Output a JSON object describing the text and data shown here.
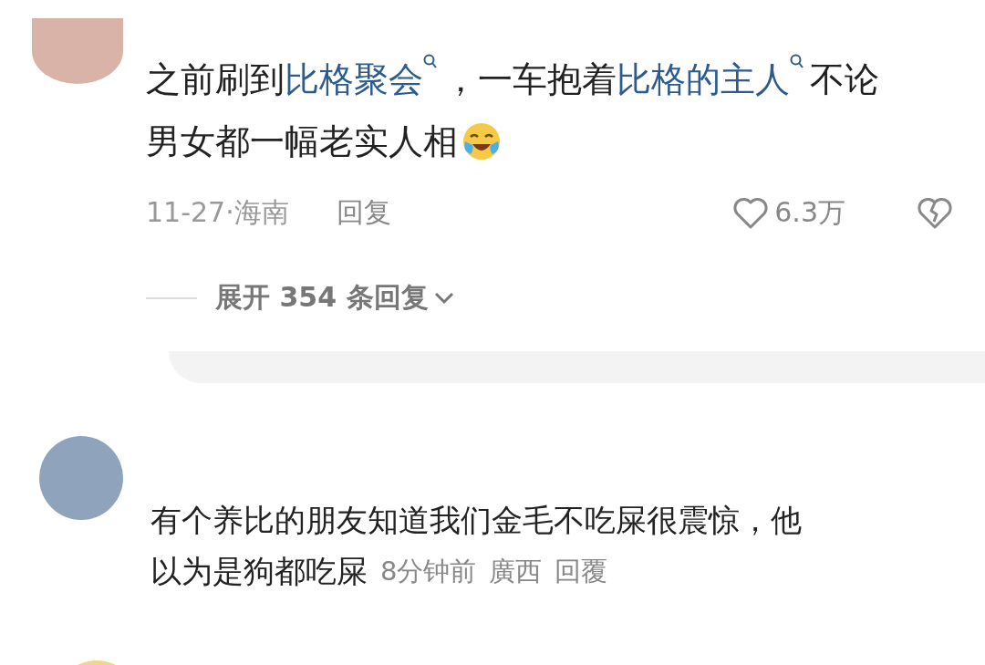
{
  "comments": [
    {
      "lines": [
        [
          {
            "kind": "plain",
            "text": "之前刷到"
          },
          {
            "kind": "keyword",
            "text": "比格聚会"
          },
          {
            "kind": "plain",
            "text": "，一车抱着"
          },
          {
            "kind": "keyword",
            "text": "比格的主人"
          },
          {
            "kind": "plain",
            "text": "不论"
          }
        ],
        [
          {
            "kind": "plain",
            "text": "男女都一幅老实人相"
          },
          {
            "kind": "emoji"
          }
        ]
      ],
      "date": "11-27·海南",
      "reply": "回复",
      "likes": "6.3万",
      "expand": "展开 354 条回复"
    },
    {
      "lines": [
        [
          {
            "kind": "plain",
            "text": "有个养比的朋友知道我们金毛不吃屎很震惊，他"
          }
        ],
        [
          {
            "kind": "plain",
            "text": "以为是狗都吃屎"
          },
          {
            "kind": "meta",
            "text": "8分钟前"
          },
          {
            "kind": "meta",
            "text": "廣西"
          },
          {
            "kind": "meta",
            "text": "回覆"
          }
        ]
      ]
    }
  ]
}
